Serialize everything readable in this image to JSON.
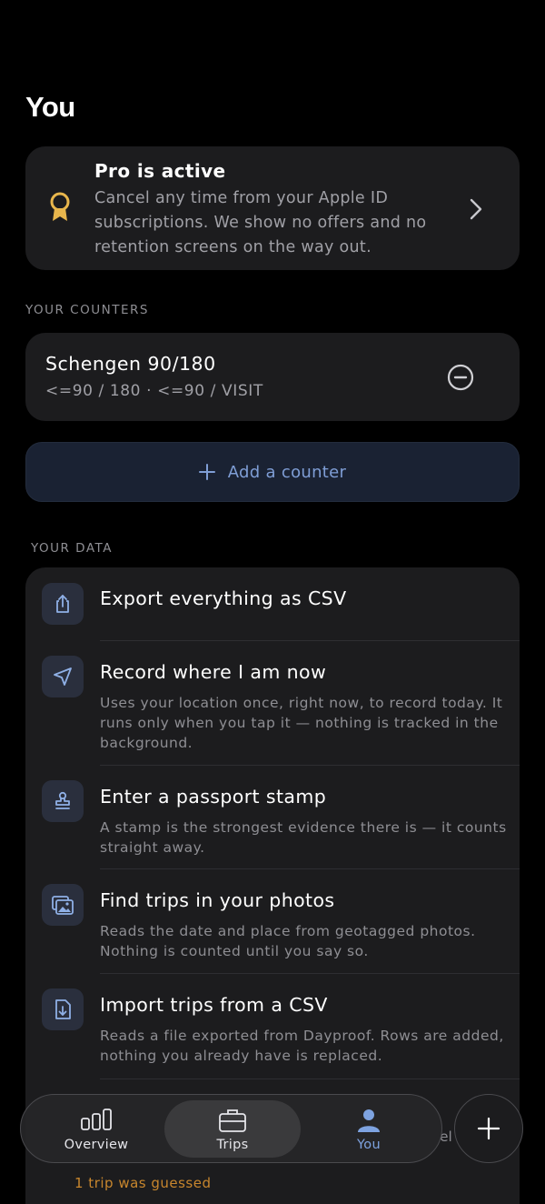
{
  "header": {
    "title": "You"
  },
  "pro": {
    "title": "Pro is active",
    "description": "Cancel any time from your Apple ID subscriptions. We show no offers and no retention screens on the way out.",
    "icon": "award-ribbon-icon",
    "icon_color": "#e8b64c"
  },
  "counters_section": {
    "label": "YOUR COUNTERS",
    "items": [
      {
        "title": "Schengen 90/180",
        "subtitle": "<=90 / 180 · <=90 / VISIT",
        "action_icon": "minus-circle-icon"
      }
    ],
    "add_label": "Add a counter"
  },
  "data_section": {
    "label": "YOUR DATA",
    "rows": [
      {
        "title": "Export everything as CSV",
        "description": "",
        "icon": "share-export-icon"
      },
      {
        "title": "Record where I am now",
        "description": "Uses your location once, right now, to record today. It runs only when you tap it — nothing is tracked in the background.",
        "icon": "location-arrow-icon"
      },
      {
        "title": "Enter a passport stamp",
        "description": "A stamp is the strongest evidence there is — it counts straight away.",
        "icon": "stamp-icon"
      },
      {
        "title": "Find trips in your photos",
        "description": "Reads the date and place from geotagged photos. Nothing is counted until you say so.",
        "icon": "photos-icon"
      },
      {
        "title": "Import trips from a CSV",
        "description": "Reads a file exported from Dayproof. Rows are added, nothing you already have is replaced.",
        "icon": "document-import-icon"
      }
    ],
    "partial_text": "el",
    "partial_warning": "1 trip was guessed"
  },
  "tab_bar": {
    "tabs": [
      {
        "label": "Overview",
        "icon": "bar-chart-icon"
      },
      {
        "label": "Trips",
        "icon": "briefcase-icon"
      },
      {
        "label": "You",
        "icon": "person-icon"
      }
    ],
    "selected": "You",
    "accent": "#7ea3e0",
    "fab_icon": "plus-icon"
  }
}
